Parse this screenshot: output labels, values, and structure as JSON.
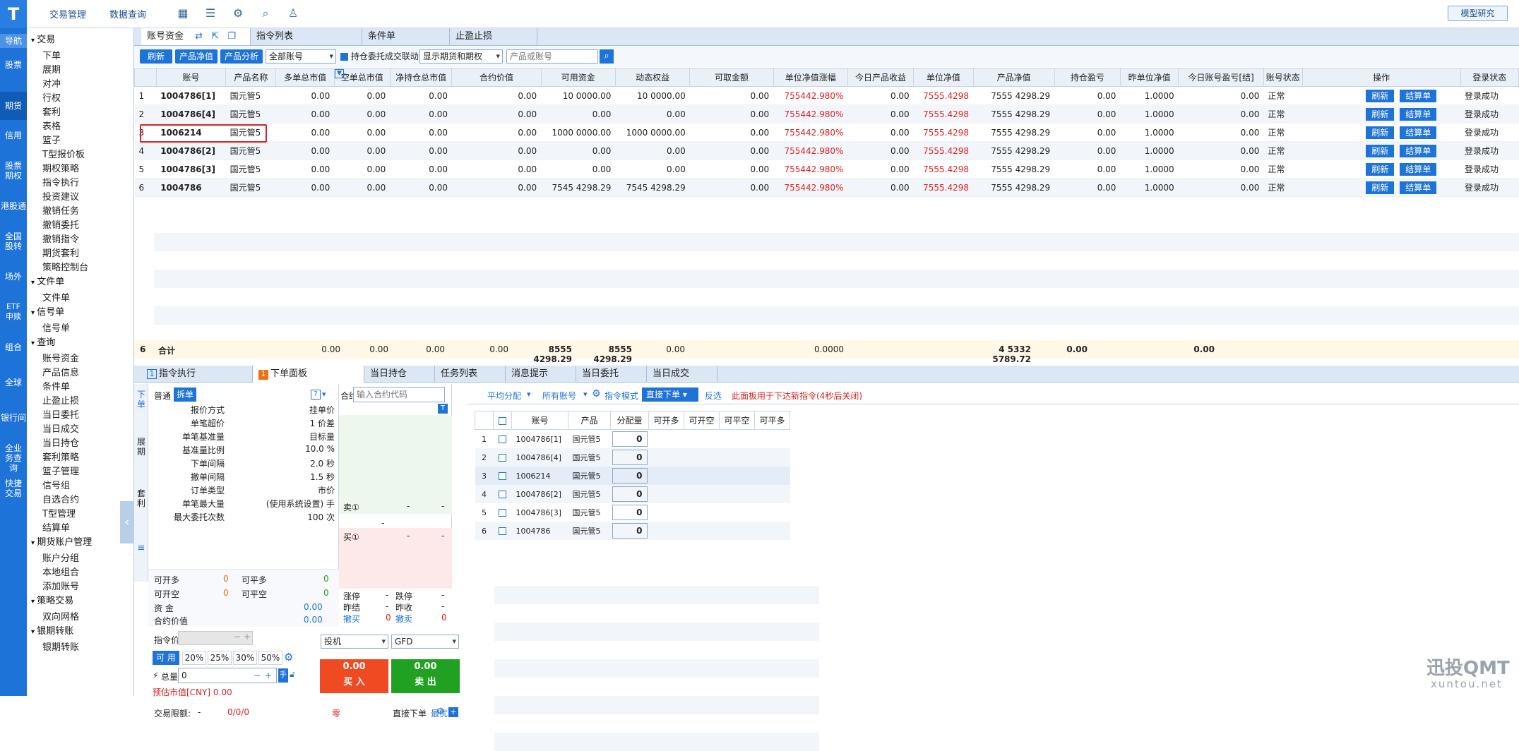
{
  "topbar": {
    "logo": "T",
    "links": [
      "交易管理",
      "数据查询"
    ],
    "model_btn": "模型研究"
  },
  "rail": [
    "导航",
    "股票",
    "期货",
    "信用",
    "股票期权",
    "港股通",
    "全国股转",
    "场外",
    "ETF申赎",
    "组合",
    "全球",
    "银行间",
    "全业务查询",
    "快捷交易"
  ],
  "nav": {
    "trade_group": "交易",
    "trade_items": [
      "下单",
      "展期",
      "对冲",
      "行权",
      "套利",
      "表格",
      "篮子",
      "T型报价板",
      "期权策略",
      "指令执行",
      "投资建议",
      "撤销任务",
      "撤销委托",
      "撤销指令",
      "期货套利",
      "策略控制台"
    ],
    "file_group": "文件单",
    "file_items": [
      "文件单"
    ],
    "signal_group": "信号单",
    "signal_items": [
      "信号单"
    ],
    "query_group": "查询",
    "query_items": [
      "账号资金",
      "产品信息",
      "条件单",
      "止盈止损",
      "当日委托",
      "当日成交",
      "当日持仓",
      "套利策略",
      "篮子管理",
      "信号组",
      "自选合约",
      "T型管理",
      "结算单"
    ],
    "futacct_group": "期货账户管理",
    "futacct_items": [
      "账户分组",
      "本地组合",
      "添加账号"
    ],
    "strat_group": "策略交易",
    "strat_items": [
      "双向网格"
    ],
    "bank_group": "银期转账",
    "bank_items": [
      "银期转账"
    ]
  },
  "top_tabs": [
    "账号资金",
    "指令列表",
    "条件单",
    "止盈止损"
  ],
  "toolbar": {
    "refresh": "刷新",
    "net_value": "产品净值",
    "analysis": "产品分析",
    "account_select": "全部账号",
    "checkbox_label": "持仓委托成交联动",
    "display_select": "显示期货和期权",
    "search_placeholder": "产品或账号"
  },
  "acct_headers": [
    "",
    "账号",
    "产品名称",
    "多单总市值",
    "空单总市值",
    "净持仓总市值",
    "合约价值",
    "可用资金",
    "动态权益",
    "可取金额",
    "单位净值涨幅",
    "今日产品收益",
    "单位净值",
    "产品净值",
    "持仓盈亏",
    "昨单位净值",
    "今日账号盈亏[结]",
    "账号状态",
    "操作",
    "登录状态"
  ],
  "acct_rows": [
    [
      "1",
      "1004786[1]",
      "国元管5",
      "0.00",
      "0.00",
      "0.00",
      "0.00",
      "10 0000.00",
      "10 0000.00",
      "0.00",
      "755442.980%",
      "0.00",
      "7555.4298",
      "7555 4298.29",
      "0.00",
      "1.0000",
      "0.00",
      "正常",
      "登录成功"
    ],
    [
      "2",
      "1004786[4]",
      "国元管5",
      "0.00",
      "0.00",
      "0.00",
      "0.00",
      "0.00",
      "0.00",
      "0.00",
      "755442.980%",
      "0.00",
      "7555.4298",
      "7555 4298.29",
      "0.00",
      "1.0000",
      "0.00",
      "正常",
      "登录成功"
    ],
    [
      "3",
      "1006214",
      "国元管5",
      "0.00",
      "0.00",
      "0.00",
      "0.00",
      "1000 0000.00",
      "1000 0000.00",
      "0.00",
      "755442.980%",
      "0.00",
      "7555.4298",
      "7555 4298.29",
      "0.00",
      "1.0000",
      "0.00",
      "正常",
      "登录成功"
    ],
    [
      "4",
      "1004786[2]",
      "国元管5",
      "0.00",
      "0.00",
      "0.00",
      "0.00",
      "0.00",
      "0.00",
      "0.00",
      "755442.980%",
      "0.00",
      "7555.4298",
      "7555 4298.29",
      "0.00",
      "1.0000",
      "0.00",
      "正常",
      "登录成功"
    ],
    [
      "5",
      "1004786[3]",
      "国元管5",
      "0.00",
      "0.00",
      "0.00",
      "0.00",
      "0.00",
      "0.00",
      "0.00",
      "755442.980%",
      "0.00",
      "7555.4298",
      "7555 4298.29",
      "0.00",
      "1.0000",
      "0.00",
      "正常",
      "登录成功"
    ],
    [
      "6",
      "1004786",
      "国元管5",
      "0.00",
      "0.00",
      "0.00",
      "0.00",
      "7545 4298.29",
      "7545 4298.29",
      "0.00",
      "755442.980%",
      "0.00",
      "7555.4298",
      "7555 4298.29",
      "0.00",
      "1.0000",
      "0.00",
      "正常",
      "登录成功"
    ]
  ],
  "row_btns": {
    "refresh": "刷新",
    "settle": "结算单"
  },
  "totals": {
    "count": "6",
    "label": "合计",
    "long": "0.00",
    "short": "0.00",
    "net": "0.00",
    "contract": "0.00",
    "avail": "8555 4298.29",
    "equity": "8555 4298.29",
    "withdraw": "0.00",
    "today_income": "0.0000",
    "net_value": "4 5332 5789.72",
    "pnl": "0.00",
    "acct_pnl": "0.00"
  },
  "bottom_tabs": [
    {
      "badge": "1",
      "label": "指令执行"
    },
    {
      "badge": "1",
      "label": "下单面板"
    },
    {
      "badge": "",
      "label": "当日持仓"
    },
    {
      "badge": "",
      "label": "任务列表"
    },
    {
      "badge": "",
      "label": "消息提示"
    },
    {
      "badge": "",
      "label": "当日委托"
    },
    {
      "badge": "",
      "label": "当日成交"
    }
  ],
  "side_tabs": [
    "下单",
    "展期",
    "套利"
  ],
  "order": {
    "mode_normal": "普通",
    "mode_split": "拆单",
    "contract_label": "合约",
    "contract_placeholder": "输入合约代码",
    "params": [
      [
        "报价方式",
        "挂单价"
      ],
      [
        "单笔超价",
        "1 价差"
      ],
      [
        "单笔基准量",
        "目标量"
      ],
      [
        "基准量比例",
        "10.0 %"
      ],
      [
        "下单间隔",
        "2.0 秒"
      ],
      [
        "撤单间隔",
        "1.5 秒"
      ],
      [
        "订单类型",
        "市价"
      ],
      [
        "单笔最大量",
        "(使用系统设置) 手"
      ],
      [
        "最大委托次数",
        "100 次"
      ]
    ],
    "ask_label": "卖①",
    "bid_label": "买①",
    "dash": "-",
    "stats": {
      "can_open_long": "可开多",
      "v1": "0",
      "can_flat_long": "可平多",
      "v2": "0",
      "can_open_short": "可开空",
      "v3": "0",
      "can_flat_short": "可平空",
      "v4": "0",
      "fund": "资  金",
      "fund_v": "0.00",
      "contract_value": "合约价值",
      "cv_v": "0.00"
    },
    "limits": {
      "up": "涨停",
      "down": "跌停",
      "prev_settle": "昨结",
      "prev_close": "昨收",
      "cancel_buy": "撤买",
      "cancel_sell": "撤卖",
      "cb_v": "0",
      "cs_v": "0"
    },
    "price_label": "指令价",
    "avail_label": "可  用",
    "pcts": [
      "20%",
      "25%",
      "30%",
      "50%"
    ],
    "total_label": "总量",
    "total_value": "0",
    "estimate": "预估市值[CNY] 0.00",
    "limit_label": "交易限额: ",
    "limit_dash": "-",
    "limit_val": "0/0/0",
    "zero": "零",
    "hedge": "投机",
    "tif": "GFD",
    "buy_price": "0.00",
    "buy_label": "买  入",
    "sell_price": "0.00",
    "sell_label": "卖  出",
    "direct": "直接下单",
    "best": "最优"
  },
  "alloc": {
    "avg": "平均分配",
    "all_acct": "所有账号",
    "mode": "指令模式",
    "direct": "直接下单",
    "reverse": "反选",
    "notice": "此面板用于下达新指令(4秒后关闭)",
    "headers": [
      "",
      "账号",
      "产品",
      "分配量",
      "可开多",
      "可开空",
      "可平空",
      "可平多"
    ],
    "rows": [
      [
        "1",
        "1004786[1]",
        "国元管5",
        "0"
      ],
      [
        "2",
        "1004786[4]",
        "国元管5",
        "0"
      ],
      [
        "3",
        "1006214",
        "国元管5",
        "0"
      ],
      [
        "4",
        "1004786[2]",
        "国元管5",
        "0"
      ],
      [
        "5",
        "1004786[3]",
        "国元管5",
        "0"
      ],
      [
        "6",
        "1004786",
        "国元管5",
        "0"
      ]
    ]
  },
  "watermark": {
    "name": "迅投QMT",
    "url": "xuntou.net"
  },
  "colors": {
    "accent": "#1e73d8",
    "red": "#e02020",
    "green": "#21a121"
  }
}
